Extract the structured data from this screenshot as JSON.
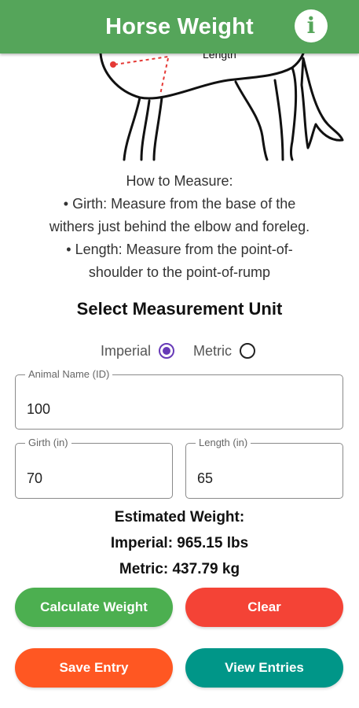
{
  "app": {
    "title": "Horse Weight",
    "info_icon": "info-icon",
    "accent": "#55a55a"
  },
  "illustration": {
    "label": "Length"
  },
  "instructions": {
    "heading": "How to Measure:",
    "girth": "• Girth: Measure from the base of the\nwithers just behind the elbow and foreleg.",
    "length": "• Length: Measure from the point-of-\nshoulder to the point-of-rump"
  },
  "unit": {
    "title": "Select Measurement Unit",
    "options": [
      {
        "label": "Imperial",
        "selected": true
      },
      {
        "label": "Metric",
        "selected": false
      }
    ],
    "radio_color": "#673ab7"
  },
  "fields": {
    "name": {
      "label": "Animal Name (ID)",
      "value": "100"
    },
    "girth": {
      "label": "Girth (in)",
      "value": "70"
    },
    "length": {
      "label": "Length (in)",
      "value": "65"
    }
  },
  "result": {
    "heading": "Estimated Weight:",
    "imperial": "Imperial: 965.15 lbs",
    "metric": "Metric: 437.79 kg"
  },
  "buttons": {
    "calculate": {
      "label": "Calculate Weight",
      "color": "#4caf50"
    },
    "clear": {
      "label": "Clear",
      "color": "#f44336"
    },
    "save": {
      "label": "Save Entry",
      "color": "#ff5722"
    },
    "view": {
      "label": "View Entries",
      "color": "#009688"
    }
  }
}
